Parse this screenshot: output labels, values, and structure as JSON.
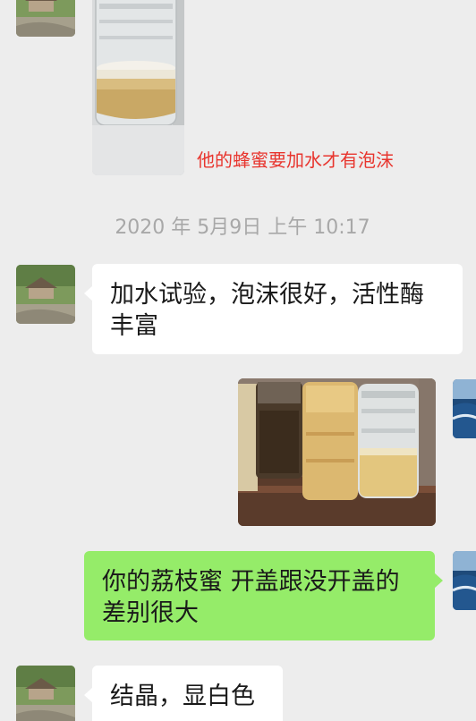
{
  "messages": [
    {
      "type": "image",
      "side": "left",
      "description_icon": "honey-jar-photo"
    },
    {
      "type": "annotation",
      "text": "他的蜂蜜要加水才有泡沫"
    },
    {
      "type": "time",
      "text": "2020 年 5月9日 上午 10:17"
    },
    {
      "type": "text",
      "side": "left",
      "lines": [
        "加水试验，泡沫很好，活性酶",
        "丰富"
      ]
    },
    {
      "type": "image",
      "side": "right",
      "description_icon": "honey-bottles-photo"
    },
    {
      "type": "text",
      "side": "right",
      "lines": [
        "你的荔枝蜜 开盖跟没开盖的",
        "差别很大"
      ]
    },
    {
      "type": "text",
      "side": "left",
      "lines": [
        "结晶，显白色"
      ]
    }
  ],
  "colors": {
    "background": "#ededed",
    "incoming_bubble": "#ffffff",
    "outgoing_bubble": "#95ec69",
    "annotation": "#e8352e",
    "timestamp": "#a8a8a8"
  }
}
